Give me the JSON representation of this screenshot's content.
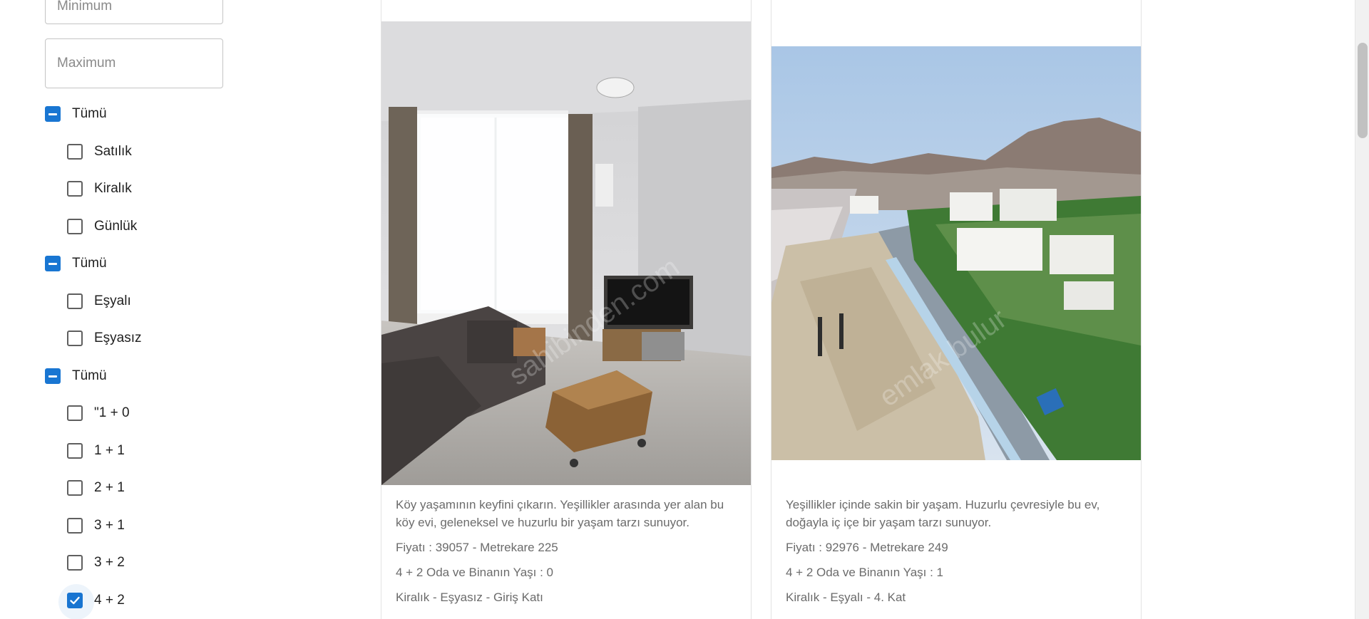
{
  "filters": {
    "price_min_placeholder": "Minimum",
    "price_max_placeholder": "Maximum",
    "groups": [
      {
        "all_label": "Tümü",
        "options": [
          {
            "label": "Satılık",
            "checked": false
          },
          {
            "label": "Kiralık",
            "checked": false
          },
          {
            "label": "Günlük",
            "checked": false
          }
        ]
      },
      {
        "all_label": "Tümü",
        "options": [
          {
            "label": "Eşyalı",
            "checked": false
          },
          {
            "label": "Eşyasız",
            "checked": false
          }
        ]
      },
      {
        "all_label": "Tümü",
        "options": [
          {
            "label": "\"1 + 0",
            "checked": false
          },
          {
            "label": "1 + 1",
            "checked": false
          },
          {
            "label": "2 + 1",
            "checked": false
          },
          {
            "label": "3 + 1",
            "checked": false
          },
          {
            "label": "3 + 2",
            "checked": false
          },
          {
            "label": "4 + 2",
            "checked": true
          }
        ]
      }
    ]
  },
  "listings": [
    {
      "description": "Köy yaşamının keyfini çıkarın. Yeşillikler arasında yer alan bu köy evi, geleneksel ve huzurlu bir yaşam tarzı sunuyor.",
      "price_line": "Fiyatı : 39057 - Metrekare 225",
      "rooms_line": "4 + 2 Oda ve Binanın Yaşı : 0",
      "type_line": "Kiralık - Eşyasız - Giriş Katı"
    },
    {
      "description": "Yeşillikler içinde sakin bir yaşam. Huzurlu çevresiyle bu ev, doğayla iç içe bir yaşam tarzı sunuyor.",
      "price_line": "Fiyatı : 92976 - Metrekare 249",
      "rooms_line": "4 + 2 Oda ve Binanın Yaşı : 1",
      "type_line": "Kiralık - Eşyalı - 4. Kat"
    }
  ],
  "colors": {
    "accent": "#1976d2",
    "text_secondary": "#6b6b6b"
  }
}
